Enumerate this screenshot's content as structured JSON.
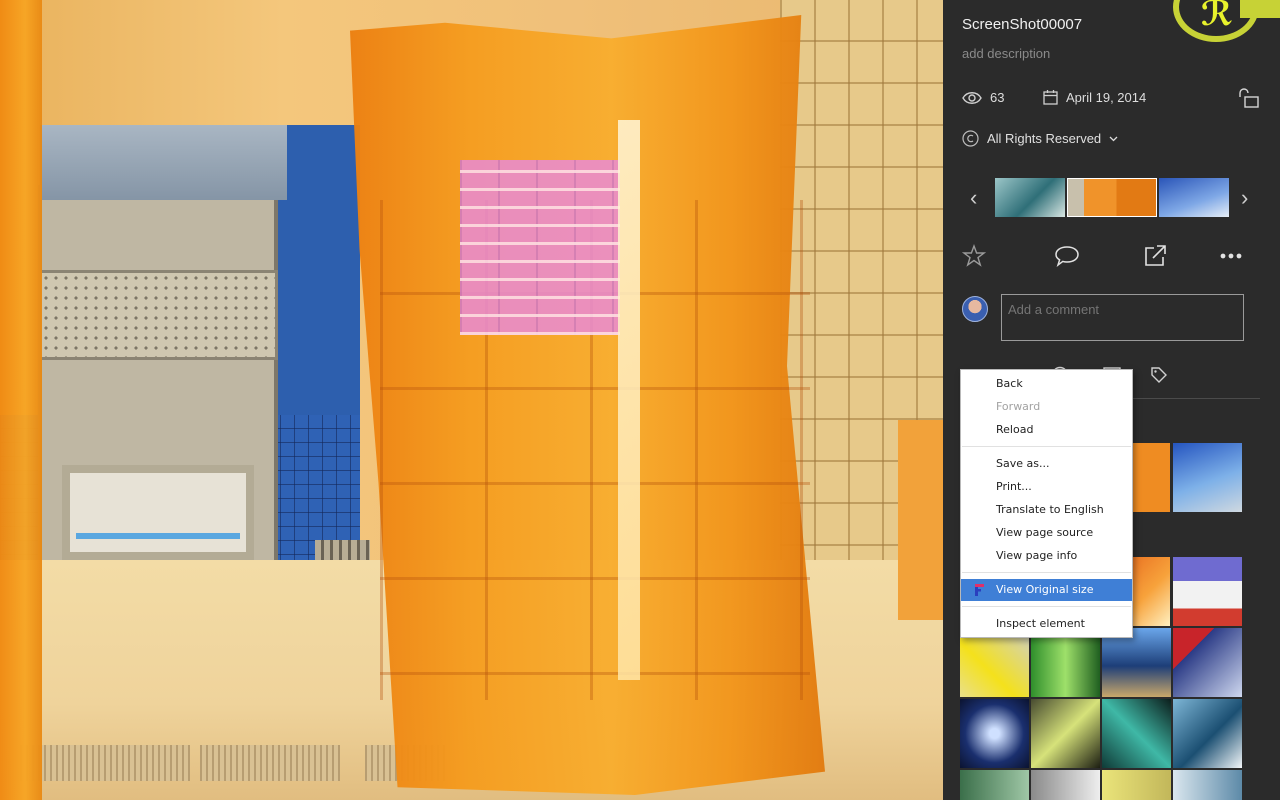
{
  "photo": {
    "title": "ScreenShot00007",
    "description_placeholder": "add description",
    "views": "63",
    "date": "April 19, 2014",
    "license": "All Rights Reserved"
  },
  "comment": {
    "placeholder": "Add a comment"
  },
  "colors": {
    "sidebar_bg": "#2b2b2b",
    "accent_logo": "#c7d236",
    "menu_highlight": "#3f7fd6"
  },
  "icons": [
    "eye-icon",
    "calendar-icon",
    "unlock-icon",
    "copyright-icon",
    "chevron-down-icon",
    "chevron-left-icon",
    "chevron-right-icon",
    "star-icon",
    "comment-icon",
    "share-icon",
    "more-icon",
    "info-icon",
    "list-icon",
    "tag-icon"
  ],
  "context_menu": {
    "items": [
      {
        "label": "Back",
        "state": "enabled"
      },
      {
        "label": "Forward",
        "state": "disabled"
      },
      {
        "label": "Reload",
        "state": "enabled"
      },
      {
        "label": "Save as...",
        "state": "enabled"
      },
      {
        "label": "Print...",
        "state": "enabled"
      },
      {
        "label": "Translate to English",
        "state": "enabled"
      },
      {
        "label": "View page source",
        "state": "enabled"
      },
      {
        "label": "View page info",
        "state": "enabled"
      },
      {
        "label": "View Original size",
        "state": "highlighted"
      },
      {
        "label": "Inspect element",
        "state": "enabled"
      }
    ]
  }
}
